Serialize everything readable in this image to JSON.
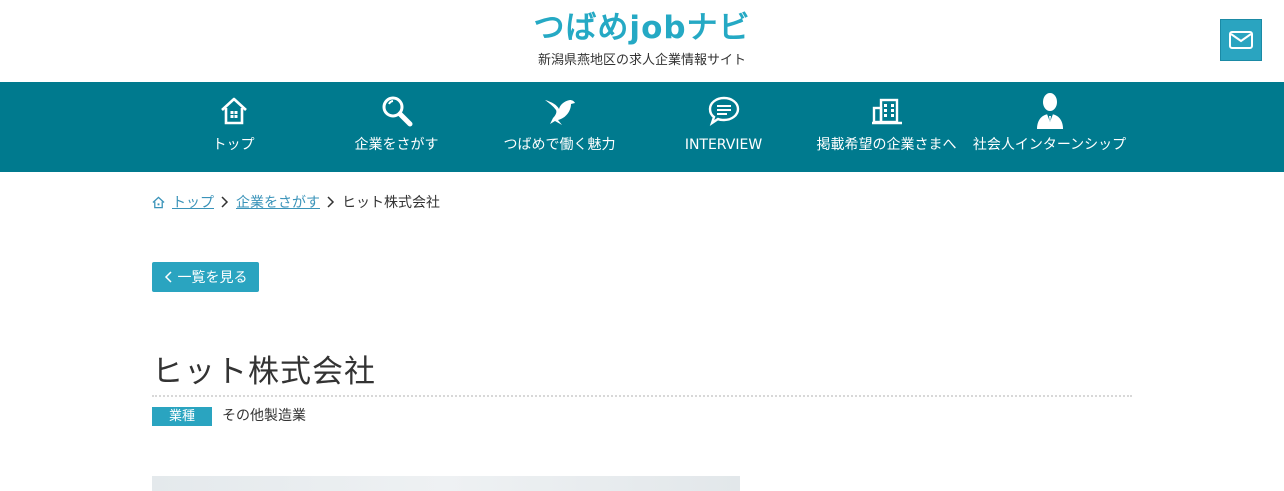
{
  "header": {
    "logo_text": "つばめjobナビ",
    "tagline": "新潟県燕地区の求人企業情報サイト",
    "mail_icon": "mail-icon"
  },
  "nav": {
    "items": [
      {
        "label": "トップ",
        "icon": "home-icon"
      },
      {
        "label": "企業をさがす",
        "icon": "search-icon"
      },
      {
        "label": "つばめで働く魅力",
        "icon": "swallow-icon"
      },
      {
        "label": "INTERVIEW",
        "icon": "speech-bubble-icon"
      },
      {
        "label": "掲載希望の企業さまへ",
        "icon": "building-icon"
      },
      {
        "label": "社会人インターンシップ",
        "icon": "person-icon"
      }
    ]
  },
  "breadcrumb": {
    "home": "トップ",
    "search": "企業をさがす",
    "current": "ヒット株式会社"
  },
  "back_button": {
    "label": "一覧を見る"
  },
  "company": {
    "name": "ヒット株式会社",
    "industry_label": "業種",
    "industry_value": "その他製造業"
  },
  "colors": {
    "accent": "#2aa4c0",
    "nav_bg": "#007a8e",
    "logo": "#25a9c4",
    "link": "#3a93b9"
  }
}
